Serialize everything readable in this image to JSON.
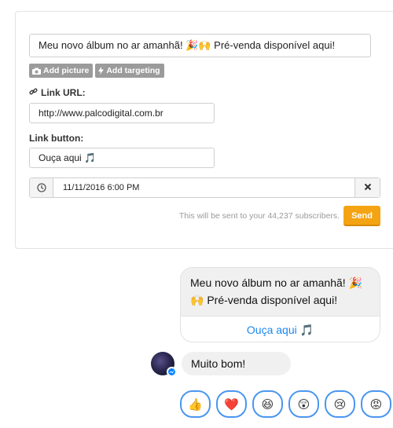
{
  "composer": {
    "message_value": "Meu novo álbum no ar amanhã! 🎉🙌 Pré-venda disponível aqui!",
    "add_picture_label": "Add picture",
    "add_targeting_label": "Add targeting",
    "link_url_label": "Link URL:",
    "link_url_value": "http://www.palcodigital.com.br",
    "link_button_label": "Link button:",
    "link_button_value": "Ouça aqui 🎵",
    "schedule_value": "11/11/2016 6:00 PM",
    "send_note": "This will be sent to your 44,237 subscribers.",
    "send_label": "Send"
  },
  "preview": {
    "line1": "Meu novo álbum no ar amanhã!  🎉",
    "line2": "🙌 Pré-venda disponível aqui!",
    "button_label": "Ouça aqui  🎵",
    "reply_text": "Muito bom!"
  },
  "reactions": [
    "👍",
    "❤️",
    "😆",
    "😲",
    "😢",
    "😡"
  ],
  "colors": {
    "send": "#f4a412",
    "link_blue": "#1b87f2",
    "reaction_border": "#4a96f0",
    "chip_gray": "#9b9b9b"
  }
}
